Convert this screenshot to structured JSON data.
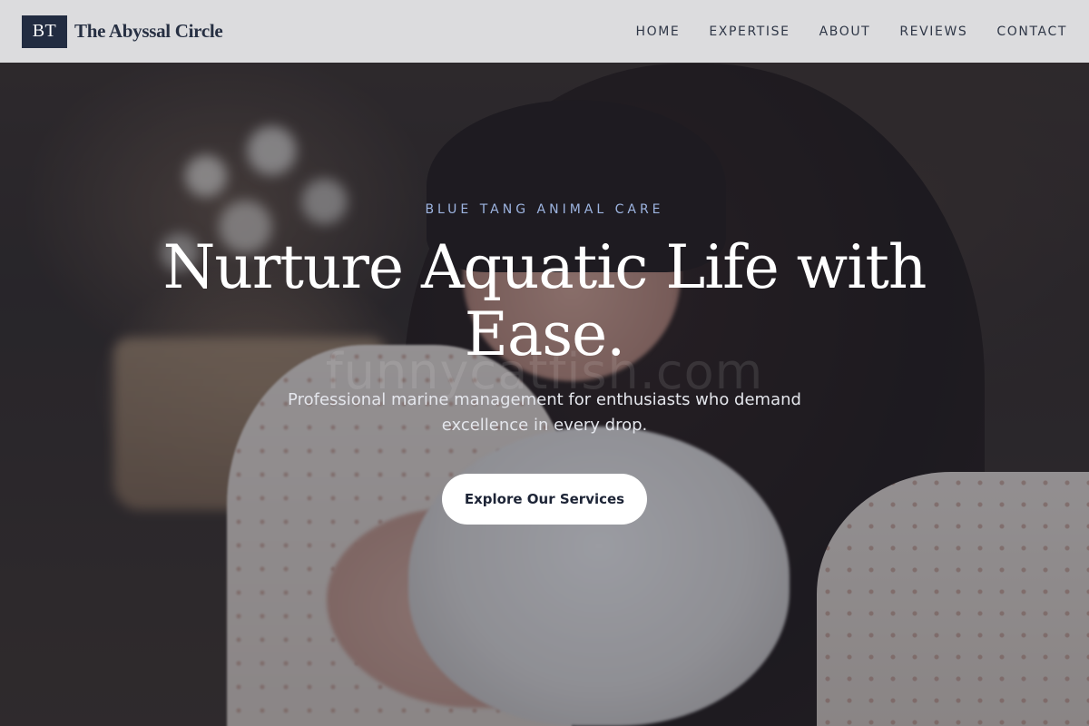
{
  "header": {
    "logo_initials": "BT",
    "brand_name": "The Abyssal Circle",
    "nav": [
      {
        "label": "HOME"
      },
      {
        "label": "EXPERTISE"
      },
      {
        "label": "ABOUT"
      },
      {
        "label": "REVIEWS"
      },
      {
        "label": "CONTACT"
      }
    ]
  },
  "hero": {
    "eyebrow": "BLUE TANG ANIMAL CARE",
    "headline": "Nurture Aquatic Life with Ease.",
    "watermark": "funnycatfish.com",
    "subtitle": "Professional marine management for enthusiasts who demand excellence in every drop.",
    "cta_label": "Explore Our Services"
  },
  "colors": {
    "brand_dark": "#222c41",
    "eyebrow_accent": "#9db4e0",
    "header_bg": "#eaeaec"
  }
}
